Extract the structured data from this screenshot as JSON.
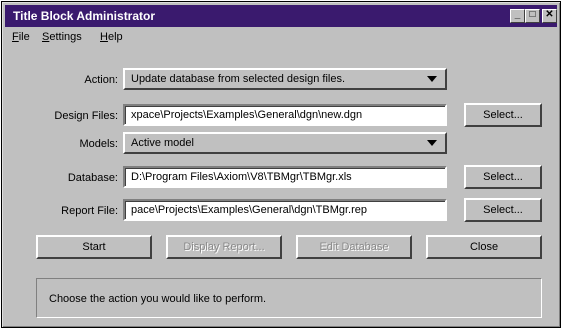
{
  "window": {
    "title": "Title Block Administrator"
  },
  "titlebar_buttons": {
    "minimize": "_",
    "maximize": "□",
    "close": "✕"
  },
  "menu": {
    "file": {
      "key": "F",
      "rest": "ile"
    },
    "settings": {
      "key": "S",
      "rest": "ettings"
    },
    "help": {
      "key": "H",
      "rest": "elp"
    }
  },
  "form": {
    "action": {
      "label": "Action:",
      "value": "Update database from selected design files."
    },
    "design_files": {
      "label": "Design Files:",
      "value": "xpace\\Projects\\Examples\\General\\dgn\\new.dgn",
      "button": "Select..."
    },
    "models": {
      "label": "Models:",
      "value": "Active model"
    },
    "database": {
      "label": "Database:",
      "value": "D:\\Program Files\\Axiom\\V8\\TBMgr\\TBMgr.xls",
      "button": "Select..."
    },
    "report_file": {
      "label": "Report File:",
      "value": "pace\\Projects\\Examples\\General\\dgn\\TBMgr.rep",
      "button": "Select..."
    }
  },
  "actions": {
    "start": "Start",
    "display_report": "Display Report...",
    "edit_database": "Edit Database",
    "close": "Close"
  },
  "status": {
    "text": "Choose the action you would like to perform."
  }
}
